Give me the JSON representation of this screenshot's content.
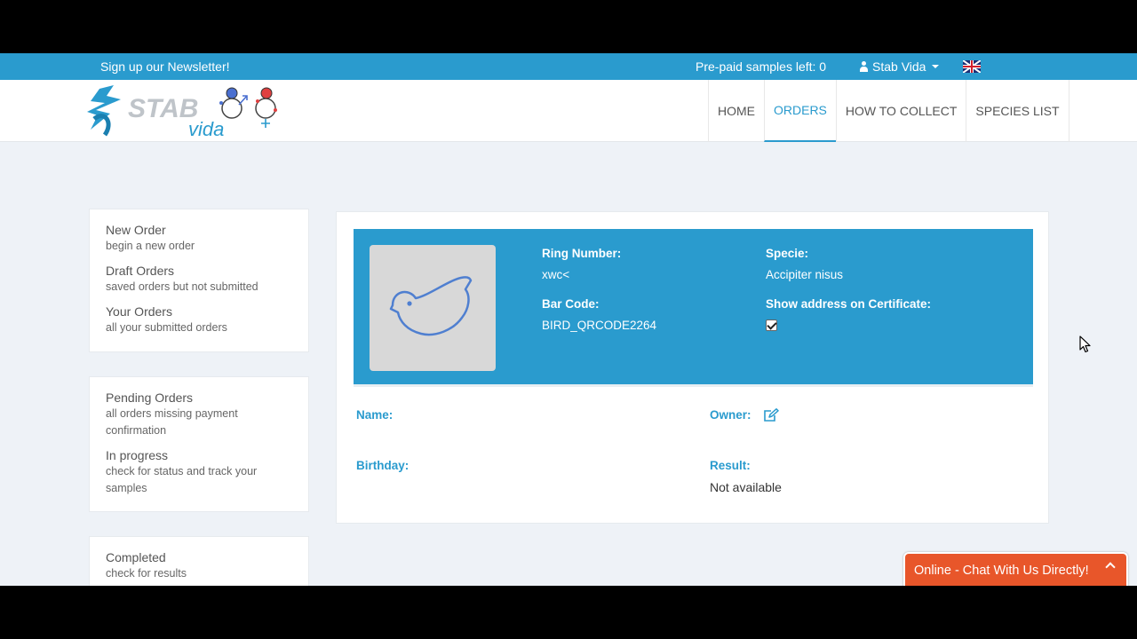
{
  "topbar": {
    "newsletter": "Sign up our Newsletter!",
    "prepaid": "Pre-paid samples left: 0",
    "user_name": "Stab Vida",
    "language_icon": "uk-flag-icon"
  },
  "brand": {
    "logo_text_top": "STAB",
    "logo_text_bottom": "vida",
    "accent": "#2a9bce",
    "chat_color": "#e8562a"
  },
  "nav": {
    "items": [
      {
        "label": "HOME"
      },
      {
        "label": "ORDERS"
      },
      {
        "label": "HOW TO COLLECT"
      },
      {
        "label": "SPECIES LIST"
      }
    ],
    "active": "ORDERS"
  },
  "sidebar": {
    "group1": [
      {
        "title": "New Order",
        "sub": "begin a new order"
      },
      {
        "title": "Draft Orders",
        "sub": "saved orders but not submitted"
      },
      {
        "title": "Your Orders",
        "sub": "all your submitted orders"
      }
    ],
    "group2": [
      {
        "title": "Pending Orders",
        "sub": "all orders missing payment confirmation"
      },
      {
        "title": "In progress",
        "sub": "check for status and track your samples"
      }
    ],
    "group3": [
      {
        "title": "Completed",
        "sub": "check for results"
      }
    ]
  },
  "order": {
    "ring_number_label": "Ring Number:",
    "ring_number": "xwc<",
    "bar_code_label": "Bar Code:",
    "bar_code": "BIRD_QRCODE2264",
    "specie_label": "Specie:",
    "specie": "Accipiter nisus",
    "show_address_label": "Show address on Certificate:",
    "show_address_checked": true,
    "name_label": "Name:",
    "owner_label": "Owner:",
    "birthday_label": "Birthday:",
    "result_label": "Result:",
    "result": "Not available"
  },
  "chat": {
    "label": "Online - Chat With Us Directly!"
  }
}
